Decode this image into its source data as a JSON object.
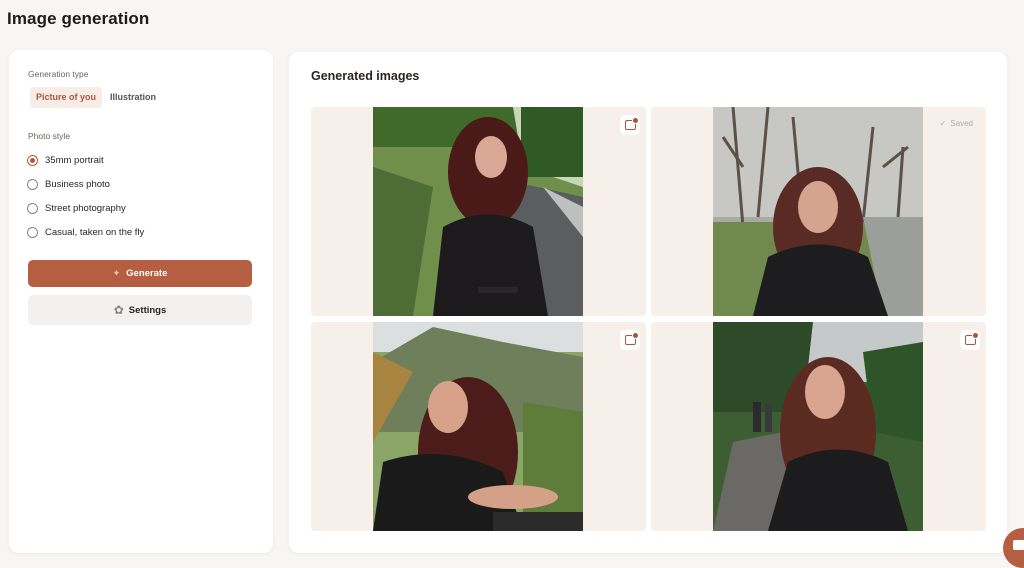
{
  "page": {
    "title": "Image generation"
  },
  "left_panel": {
    "generation_type_label": "Generation type",
    "type_tabs": [
      {
        "label": "Picture of you",
        "active": true
      },
      {
        "label": "Illustration",
        "active": false
      }
    ],
    "photo_style_label": "Photo style",
    "photo_styles": [
      {
        "label": "35mm portrait",
        "checked": true
      },
      {
        "label": "Business photo",
        "checked": false
      },
      {
        "label": "Street photography",
        "checked": false
      },
      {
        "label": "Casual, taken on the fly",
        "checked": false
      }
    ],
    "generate_label": "Generate",
    "settings_label": "Settings"
  },
  "gallery": {
    "title": "Generated images",
    "images": [
      {
        "status": "unsaved",
        "icon": "save-image-icon"
      },
      {
        "status": "saved",
        "saved_label": "Saved",
        "icon": "check-icon"
      },
      {
        "status": "unsaved",
        "icon": "save-image-icon"
      },
      {
        "status": "unsaved",
        "icon": "save-image-icon"
      }
    ]
  },
  "colors": {
    "accent": "#b65e42",
    "accent_soft": "#f7ece6",
    "background": "#f8f6f4",
    "tile_background": "#f7efea"
  }
}
